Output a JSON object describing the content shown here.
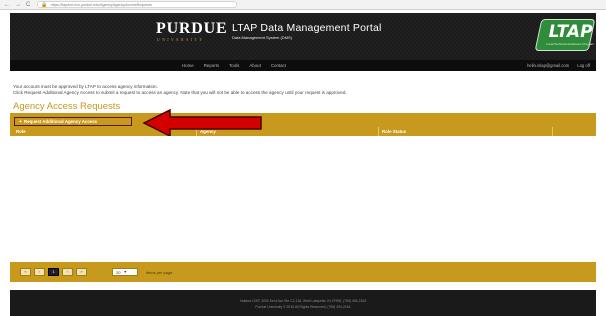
{
  "browser": {
    "back": "←",
    "forward": "→",
    "reload": "C",
    "url": "https://ltapdmr.ecn.purdue.edu/Agency/AgencyAccessRequests"
  },
  "header": {
    "university_name": "PURDUE",
    "university_sub": "UNIVERSITY",
    "portal_title": "LTAP Data Management Portal",
    "portal_subtitle": "Data Management System (DMS)",
    "logo_text": "LTAP",
    "logo_subtext": "Local Technical Assistance Program"
  },
  "nav": {
    "items": [
      {
        "label": "Home"
      },
      {
        "label": "Reports"
      },
      {
        "label": "Tools"
      },
      {
        "label": "About"
      },
      {
        "label": "Contact"
      }
    ],
    "user_email": "hello.inlap@gmail.com",
    "logout": "Log off"
  },
  "messages": {
    "line1": "Your account must be approved by LTAP to access agency information.",
    "line2": "Click Request Additional Agency Access to submit a request to access an agency. Note that you will not be able to access the agency until your request is approved."
  },
  "page": {
    "title": "Agency Access Requests",
    "request_button": "Request Additional Agency Access",
    "columns": [
      "Role",
      "Agency",
      "Role Status"
    ]
  },
  "pager": {
    "buttons": [
      "«",
      "‹",
      "1",
      "›",
      "»"
    ],
    "current_index": 2,
    "page_size": "20",
    "items_per_page": "items per page"
  },
  "footer": {
    "line1": "Indiana LTAP, 3000 Kent Ave Ste C2-118, West Lafayette, IN 47906, (765) 494-2164",
    "line2": "Purdue University © 2016 All Rights Reserved | (765) 494-2164"
  },
  "colors": {
    "gold": "#c79a1e",
    "title_gold": "#c29a1f",
    "header_dark": "#1a1a1a",
    "arrow_red": "#d40000",
    "logo_green": "#2f8c3a"
  }
}
